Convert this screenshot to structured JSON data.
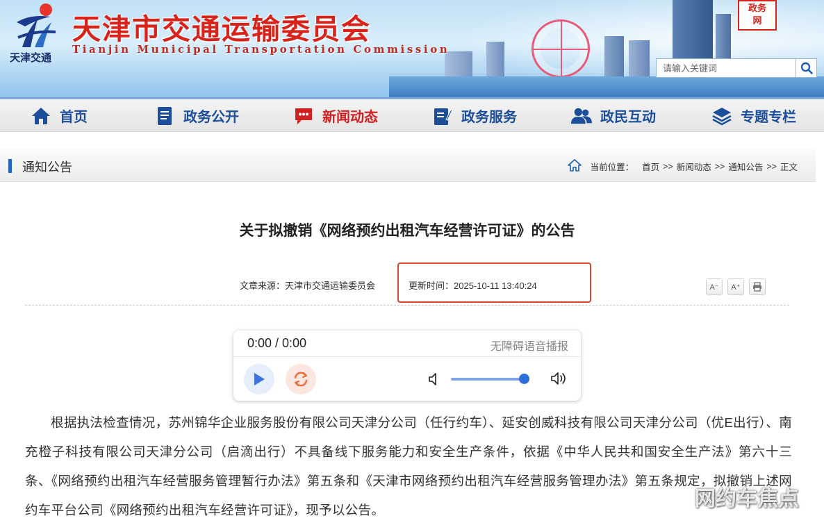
{
  "header": {
    "logo_text": "天津交通",
    "site_title": "天津市交通运输委员会",
    "site_subtitle": "Tianjin Municipal Transportation Commission",
    "gov_badge": "政务\n网",
    "search_placeholder": "请输入关键词"
  },
  "nav": {
    "items": [
      {
        "label": "首页",
        "icon": "home-icon"
      },
      {
        "label": "政务公开",
        "icon": "document-icon"
      },
      {
        "label": "新闻动态",
        "icon": "chat-icon"
      },
      {
        "label": "政务服务",
        "icon": "edit-icon"
      },
      {
        "label": "政民互动",
        "icon": "users-icon"
      },
      {
        "label": "专题专栏",
        "icon": "layers-icon"
      }
    ],
    "active_index": 2
  },
  "section": {
    "title": "通知公告",
    "breadcrumb": {
      "prefix": "当前位置：",
      "items": [
        "首页",
        "新闻动态",
        "通知公告",
        "正文"
      ],
      "separator": ">>"
    }
  },
  "article": {
    "title": "关于拟撤销《网络预约出租汽车经营许可证》的公告",
    "source": "文章来源：天津市交通运输委员会",
    "updated": "更新时间：2025-10-11 13:40:24",
    "tools": {
      "font_smaller": "A⁻",
      "font_larger": "A⁺"
    },
    "body": "根据执法检查情况，苏州锦华企业服务股份有限公司天津分公司（任行约车）、延安创威科技有限公司天津分公司（优E出行）、南充橙子科技有限公司天津分公司（启滴出行）不具备线下服务能力和安全生产条件，依据《中华人民共和国安全生产法》第六十三条、《网络预约出租汽车经营服务管理暂行办法》第五条和《天津市网络预约出租汽车经营服务管理办法》第五条规定，拟撤销上述网约车平台公司《网络预约出租汽车经营许可证》，现予以公告。"
  },
  "player": {
    "time": "0:00 / 0:00",
    "label": "无障碍语音播报",
    "volume": 0.95
  },
  "watermark": "网约车焦点",
  "colors": {
    "brand_red": "#d8231b",
    "nav_blue": "#1d4e9a",
    "nav_active": "#d21f1f",
    "highlight_box": "#d9462e",
    "accent_blue": "#1c67c4"
  }
}
